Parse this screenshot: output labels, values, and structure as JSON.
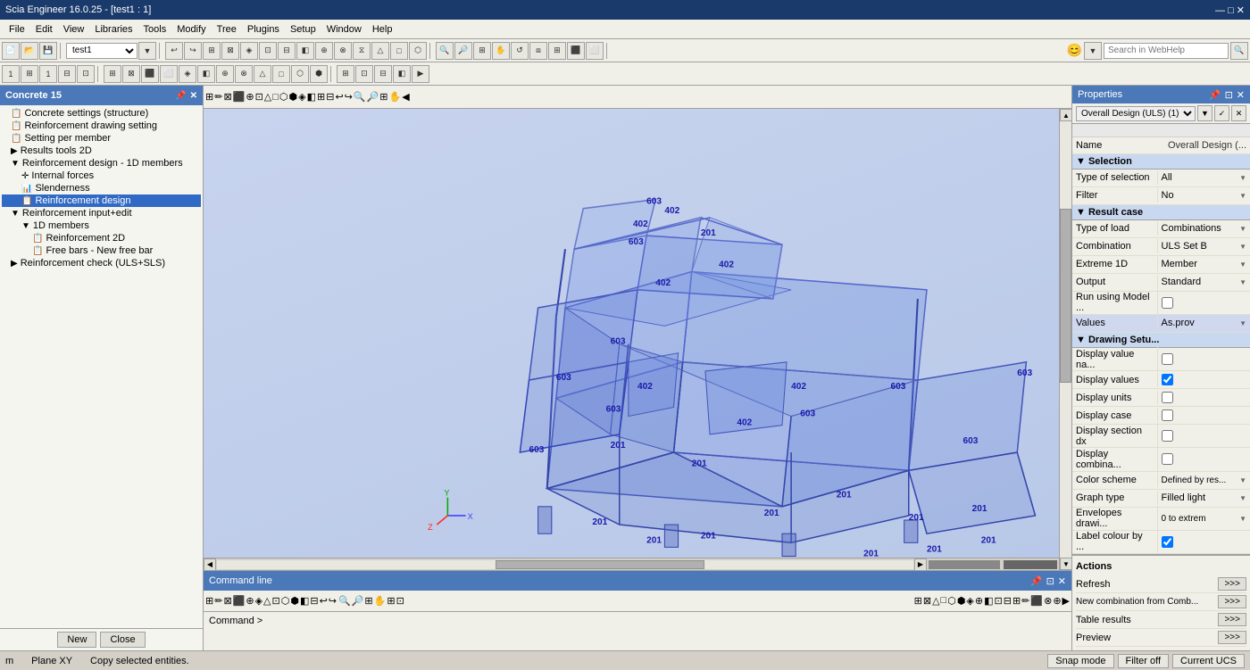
{
  "titlebar": {
    "title": "Scia Engineer 16.0.25 - [test1 : 1]",
    "controls": [
      "—",
      "□",
      "✕"
    ]
  },
  "menubar": {
    "items": [
      "File",
      "Edit",
      "View",
      "Libraries",
      "Tools",
      "Modify",
      "Tree",
      "Plugins",
      "Setup",
      "Window",
      "Help"
    ]
  },
  "toolbar1": {
    "combo_value": "test1",
    "webhelp_placeholder": "Search in WebHelp"
  },
  "left_panel": {
    "title": "Concrete 15",
    "items": [
      {
        "label": "Concrete settings (structure)",
        "indent": 1,
        "icon": "📋",
        "selected": false
      },
      {
        "label": "Reinforcement drawing setting",
        "indent": 1,
        "icon": "📋",
        "selected": false
      },
      {
        "label": "Setting per member",
        "indent": 1,
        "icon": "📋",
        "selected": false
      },
      {
        "label": "Results tools 2D",
        "indent": 1,
        "icon": "📁",
        "selected": false
      },
      {
        "label": "Reinforcement design - 1D members",
        "indent": 1,
        "icon": "📁",
        "selected": false
      },
      {
        "label": "Internal forces",
        "indent": 2,
        "icon": "✛",
        "selected": false
      },
      {
        "label": "Slenderness",
        "indent": 2,
        "icon": "📊",
        "selected": false
      },
      {
        "label": "Reinforcement design",
        "indent": 2,
        "icon": "📋",
        "selected": true
      },
      {
        "label": "Reinforcement input+edit",
        "indent": 1,
        "icon": "📁",
        "selected": false
      },
      {
        "label": "1D members",
        "indent": 2,
        "icon": "📁",
        "selected": false
      },
      {
        "label": "Reinforcement 2D",
        "indent": 2,
        "icon": "📋",
        "selected": false
      },
      {
        "label": "Free bars - New free bar",
        "indent": 2,
        "icon": "📋",
        "selected": false
      },
      {
        "label": "Reinforcement check (ULS+SLS)",
        "indent": 1,
        "icon": "📁",
        "selected": false
      }
    ],
    "btn_new": "New",
    "btn_close": "Close"
  },
  "properties": {
    "title": "Properties",
    "top_combo": "Overall Design (ULS) (1)",
    "name_label": "Name",
    "name_value": "Overall Design (...",
    "sections": [
      {
        "title": "Selection",
        "rows": [
          {
            "label": "Type of selection",
            "value": "All",
            "type": "dropdown"
          },
          {
            "label": "Filter",
            "value": "No",
            "type": "dropdown"
          }
        ]
      },
      {
        "title": "Result case",
        "rows": [
          {
            "label": "Type of load",
            "value": "Combinations",
            "type": "dropdown"
          },
          {
            "label": "Combination",
            "value": "ULS Set B",
            "type": "dropdown"
          },
          {
            "label": "Extreme 1D",
            "value": "Member",
            "type": "dropdown"
          },
          {
            "label": "Output",
            "value": "Standard",
            "type": "dropdown"
          },
          {
            "label": "Run using Model ...",
            "value": false,
            "type": "checkbox"
          },
          {
            "label": "Values",
            "value": "As.prov",
            "type": "dropdown",
            "highlight": true
          }
        ]
      },
      {
        "title": "Drawing Setu...",
        "rows": [
          {
            "label": "Display value na...",
            "value": false,
            "type": "checkbox"
          },
          {
            "label": "Display values",
            "value": true,
            "type": "checkbox"
          },
          {
            "label": "Display units",
            "value": false,
            "type": "checkbox"
          },
          {
            "label": "Display case",
            "value": false,
            "type": "checkbox"
          },
          {
            "label": "Display section dx",
            "value": false,
            "type": "checkbox"
          },
          {
            "label": "Display combina...",
            "value": false,
            "type": "checkbox"
          },
          {
            "label": "Color scheme",
            "value": "Defined by res...",
            "type": "dropdown"
          },
          {
            "label": "Graph type",
            "value": "Filled light",
            "type": "dropdown"
          },
          {
            "label": "Envelopes drawi...",
            "value": "0 to extrem",
            "type": "dropdown"
          },
          {
            "label": "Label colour by ...",
            "value": true,
            "type": "checkbox"
          }
        ]
      }
    ],
    "actions": {
      "title": "Actions",
      "items": [
        {
          "label": "Refresh",
          "btn": ">>>"
        },
        {
          "label": "New combination from Comb...",
          "btn": ">>>"
        },
        {
          "label": "Table results",
          "btn": ">>>"
        },
        {
          "label": "Preview",
          "btn": ">>>"
        }
      ]
    }
  },
  "viewport": {
    "numbers": [
      "201",
      "201",
      "201",
      "201",
      "201",
      "201",
      "402",
      "402",
      "402",
      "603",
      "603",
      "603",
      "603",
      "603",
      "603",
      "603",
      "603"
    ]
  },
  "statusbar": {
    "coord_m": "m",
    "plane": "Plane XY",
    "copy_text": "Copy selected entities.",
    "snap_mode": "Snap mode",
    "filter_off": "Filter off",
    "current_ucs": "Current UCS"
  },
  "cmdline": {
    "title": "Command line",
    "prompt": "Command >"
  }
}
